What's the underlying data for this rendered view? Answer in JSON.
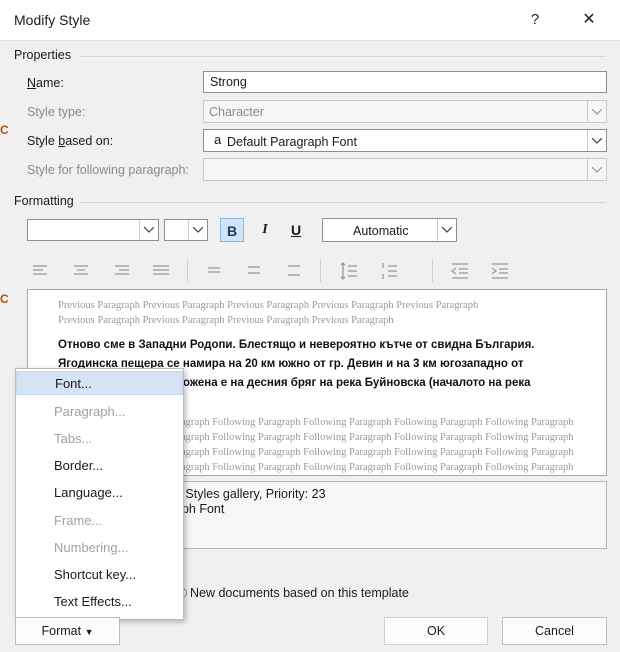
{
  "window": {
    "title": "Modify Style",
    "help_label": "?",
    "close_label": "✕"
  },
  "properties": {
    "section_label": "Properties",
    "name_label": "Name:",
    "name_value": "Strong",
    "style_type_label": "Style type:",
    "style_type_value": "Character",
    "based_on_label": "Style based on:",
    "based_on_glyph": "a",
    "based_on_value": "Default Paragraph Font",
    "following_label": "Style for following paragraph:",
    "following_value": ""
  },
  "formatting": {
    "section_label": "Formatting",
    "font_name": "",
    "font_size": "",
    "bold_label": "B",
    "italic_label": "I",
    "underline_label": "U",
    "color_value": "Automatic"
  },
  "preview": {
    "previous_lines": [
      "Previous Paragraph Previous Paragraph Previous Paragraph Previous Paragraph Previous Paragraph",
      "Previous Paragraph Previous Paragraph Previous Paragraph Previous Paragraph"
    ],
    "main_lines": [
      "Отново сме в Западни Родопи. Блестящо и невероятно кътче от свидна България.",
      "Ягодинска пещера се намира на 20 км южно от гр. Девин и на 3 км югозападно от",
      "ожена е на десния бряг на река Буйновска (началото на река"
    ],
    "following_lines": [
      "аgraph Following Paragraph Following Paragraph Following Paragraph Following Paragraph",
      "аgraph Following Paragraph Following Paragraph Following Paragraph Following Paragraph",
      "аgraph Following Paragraph Following Paragraph Following Paragraph Following Paragraph",
      "аgraph Following Paragraph Following Paragraph Following Paragraph Following Paragraph"
    ]
  },
  "description": {
    "line1": "e Styles gallery, Priority: 23",
    "line2": "aph Font"
  },
  "options": {
    "new_docs_label": "New documents based on this template"
  },
  "menu": {
    "items": [
      {
        "label": "Font...",
        "enabled": true,
        "highlighted": true
      },
      {
        "label": "Paragraph...",
        "enabled": false
      },
      {
        "label": "Tabs...",
        "enabled": false
      },
      {
        "label": "Border...",
        "enabled": true
      },
      {
        "label": "Language...",
        "enabled": true
      },
      {
        "label": "Frame...",
        "enabled": false
      },
      {
        "label": "Numbering...",
        "enabled": false
      },
      {
        "label": "Shortcut key...",
        "enabled": true
      },
      {
        "label": "Text Effects...",
        "enabled": true
      }
    ]
  },
  "buttons": {
    "format_label": "Format",
    "ok_label": "OK",
    "cancel_label": "Cancel"
  },
  "colors": {
    "highlight": "#d5e3f4",
    "bold_toggle": "#cfe4f7"
  }
}
